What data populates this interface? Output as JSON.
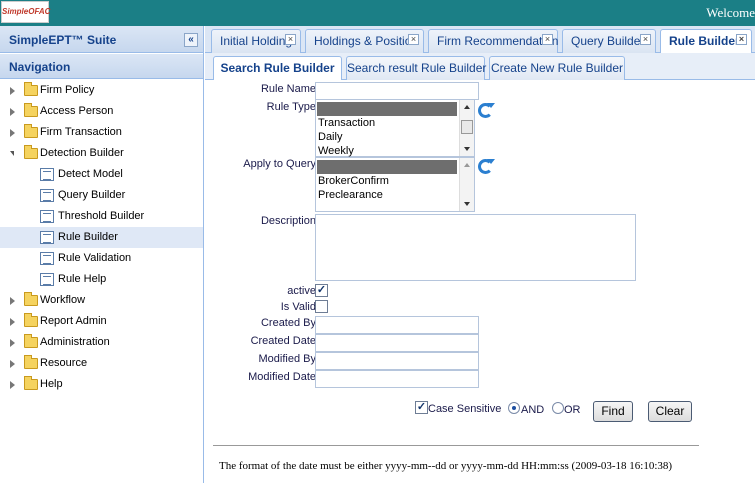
{
  "app": {
    "logo_text": "SimpleOFAC",
    "welcome_text": "Welcome"
  },
  "sidebar": {
    "suite_title": "SimpleEPT™ Suite",
    "collapse_glyph": "«",
    "nav_title": "Navigation",
    "items": [
      {
        "label": "Firm Policy",
        "type": "folder",
        "expanded": false,
        "selected": false
      },
      {
        "label": "Access Person",
        "type": "folder",
        "expanded": false,
        "selected": false
      },
      {
        "label": "Firm Transaction",
        "type": "folder",
        "expanded": false,
        "selected": false
      },
      {
        "label": "Detection Builder",
        "type": "folder",
        "expanded": true,
        "selected": false
      },
      {
        "label": "Detect Model",
        "type": "doc",
        "selected": false
      },
      {
        "label": "Query Builder",
        "type": "doc",
        "selected": false
      },
      {
        "label": "Threshold Builder",
        "type": "doc",
        "selected": false
      },
      {
        "label": "Rule Builder",
        "type": "doc",
        "selected": true
      },
      {
        "label": "Rule Validation",
        "type": "doc",
        "selected": false
      },
      {
        "label": "Rule Help",
        "type": "doc",
        "selected": false
      },
      {
        "label": "Workflow",
        "type": "folder",
        "expanded": false,
        "selected": false
      },
      {
        "label": "Report Admin",
        "type": "folder",
        "expanded": false,
        "selected": false
      },
      {
        "label": "Administration",
        "type": "folder",
        "expanded": false,
        "selected": false
      },
      {
        "label": "Resource",
        "type": "folder",
        "expanded": false,
        "selected": false
      },
      {
        "label": "Help",
        "type": "folder",
        "expanded": false,
        "selected": false
      }
    ]
  },
  "tabs": [
    {
      "label": "Initial Holding",
      "active": false
    },
    {
      "label": "Holdings & Position",
      "active": false
    },
    {
      "label": "Firm Recommendation",
      "active": false
    },
    {
      "label": "Query Builder",
      "active": false
    },
    {
      "label": "Rule Builder",
      "active": true
    }
  ],
  "tab_close_glyph": "×",
  "subtabs": [
    {
      "label": "Search Rule Builder",
      "active": true
    },
    {
      "label": "Search result Rule Builder",
      "active": false
    },
    {
      "label": "Create New Rule Builder",
      "active": false
    }
  ],
  "form": {
    "rule_name_label": "Rule Name",
    "rule_name_value": "",
    "rule_type_label": "Rule Type",
    "rule_type_options": [
      "Transaction",
      "Daily",
      "Weekly"
    ],
    "apply_to_query_label": "Apply to Query",
    "apply_to_query_options": [
      "BrokerConfirm",
      "Preclearance"
    ],
    "description_label": "Description",
    "description_value": "",
    "active_label": "active",
    "active_checked": true,
    "is_valid_label": "Is Valid",
    "is_valid_checked": false,
    "created_by_label": "Created By",
    "created_date_label": "Created Date",
    "modified_by_label": "Modified By",
    "modified_date_label": "Modified Date",
    "case_sensitive_label": "Case Sensitive",
    "case_sensitive_checked": true,
    "and_label": "AND",
    "or_label": "OR",
    "logic_selected": "AND",
    "find_button": "Find",
    "clear_button": "Clear",
    "check_glyph": "✓",
    "footnote": "The format of the date must be either yyyy-mm--dd or yyyy-mm-dd HH:mm:ss (2009-03-18 16:10:38)"
  }
}
